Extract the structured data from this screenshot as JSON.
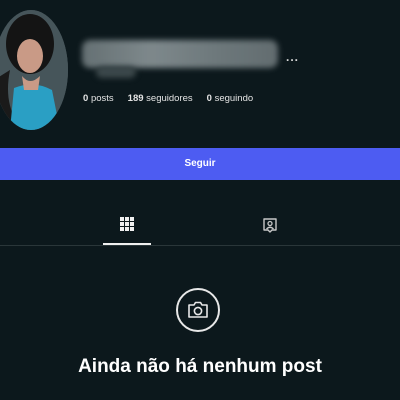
{
  "profile": {
    "more_label": "...",
    "stats": {
      "posts_count": "0",
      "posts_label": "posts",
      "followers_count": "189",
      "followers_label": "seguidores",
      "following_count": "0",
      "following_label": "seguindo"
    }
  },
  "actions": {
    "follow_label": "Seguir"
  },
  "tabs": [
    {
      "icon": "grid-icon",
      "selected": true
    },
    {
      "icon": "tagged-person-icon",
      "selected": false
    }
  ],
  "empty_state": {
    "icon": "camera-icon",
    "title": "Ainda não há nenhum post"
  },
  "colors": {
    "background": "#0c181c",
    "accent": "#4d5cf2",
    "text": "#ffffff"
  }
}
